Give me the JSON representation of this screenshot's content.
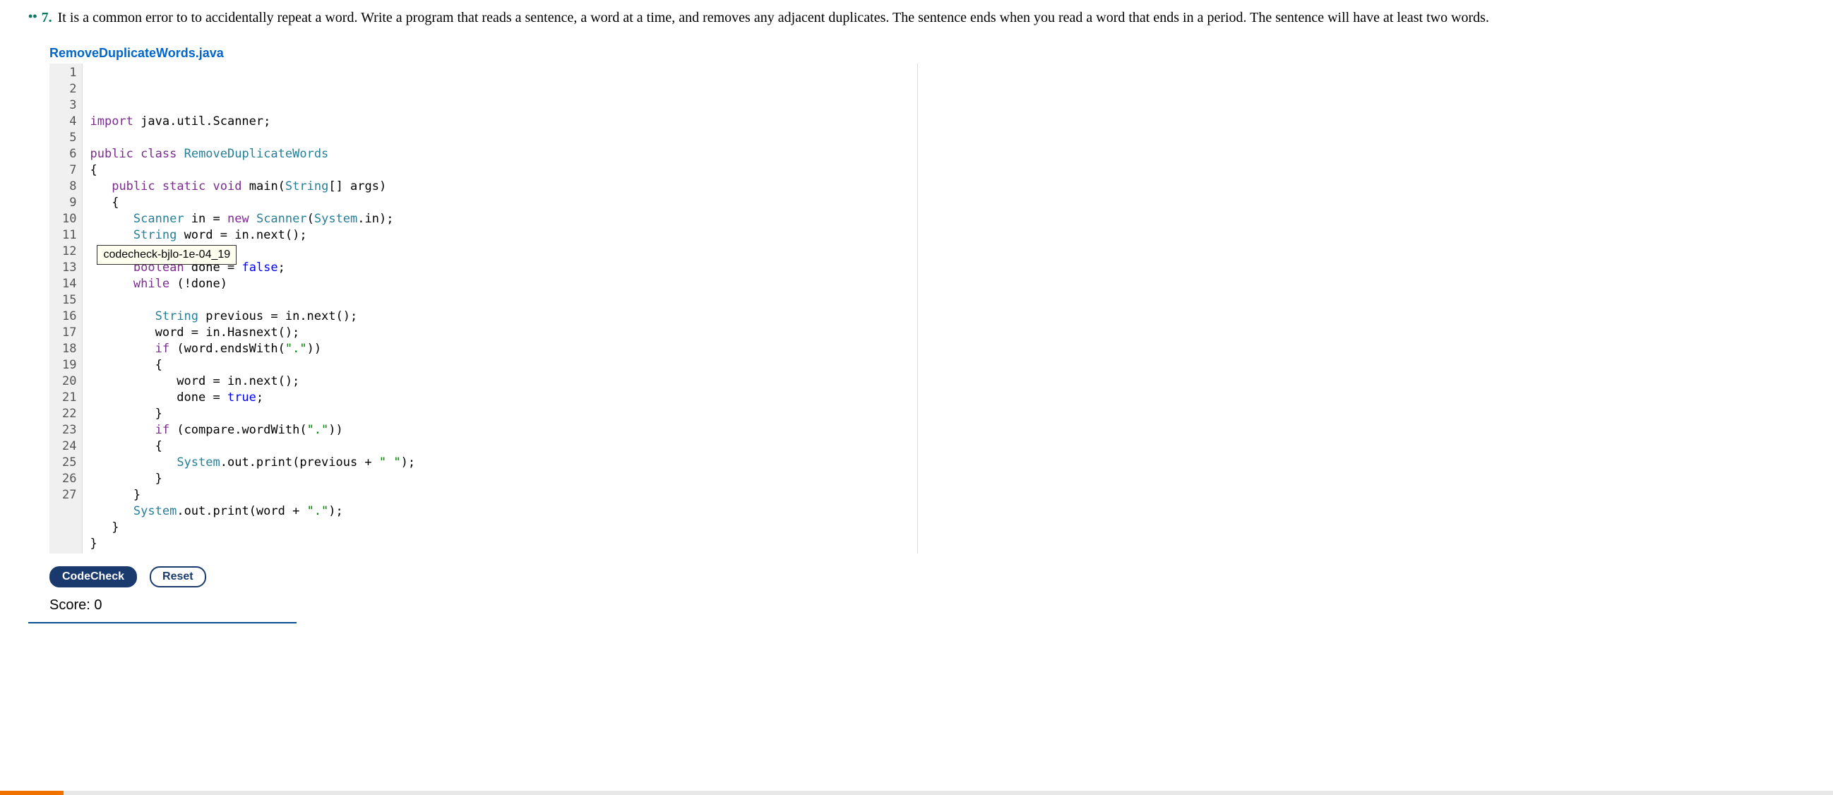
{
  "problem": {
    "bullets": "••",
    "number": "7.",
    "text": "It is a common error to to accidentally repeat a word. Write a program that reads a sentence, a word at a time, and removes any adjacent duplicates. The sentence ends when you read a word that ends in a period. The sentence will have at least two words."
  },
  "filename": "RemoveDuplicateWords.java",
  "tooltip": "codecheck-bjlo-1e-04_19",
  "code": {
    "lines": [
      {
        "n": "1",
        "tokens": [
          {
            "t": "import",
            "c": "kw-purple"
          },
          {
            "t": " java.util.Scanner;",
            "c": "ident"
          }
        ]
      },
      {
        "n": "2",
        "tokens": []
      },
      {
        "n": "3",
        "tokens": [
          {
            "t": "public",
            "c": "kw-purple"
          },
          {
            "t": " ",
            "c": ""
          },
          {
            "t": "class",
            "c": "kw-purple"
          },
          {
            "t": " ",
            "c": ""
          },
          {
            "t": "RemoveDuplicateWords",
            "c": "type"
          }
        ]
      },
      {
        "n": "4",
        "tokens": [
          {
            "t": "{",
            "c": "ident"
          }
        ]
      },
      {
        "n": "5",
        "tokens": [
          {
            "t": "   ",
            "c": ""
          },
          {
            "t": "public",
            "c": "kw-purple"
          },
          {
            "t": " ",
            "c": ""
          },
          {
            "t": "static",
            "c": "kw-purple"
          },
          {
            "t": " ",
            "c": ""
          },
          {
            "t": "void",
            "c": "kw-purple"
          },
          {
            "t": " main(",
            "c": "ident"
          },
          {
            "t": "String",
            "c": "type"
          },
          {
            "t": "[] args)",
            "c": "ident"
          }
        ]
      },
      {
        "n": "6",
        "tokens": [
          {
            "t": "   {",
            "c": "ident"
          }
        ]
      },
      {
        "n": "7",
        "tokens": [
          {
            "t": "      ",
            "c": ""
          },
          {
            "t": "Scanner",
            "c": "type"
          },
          {
            "t": " in = ",
            "c": "ident"
          },
          {
            "t": "new",
            "c": "kw-purple"
          },
          {
            "t": " ",
            "c": ""
          },
          {
            "t": "Scanner",
            "c": "type"
          },
          {
            "t": "(",
            "c": "ident"
          },
          {
            "t": "System",
            "c": "type"
          },
          {
            "t": ".in);",
            "c": "ident"
          }
        ]
      },
      {
        "n": "8",
        "tokens": [
          {
            "t": "      ",
            "c": ""
          },
          {
            "t": "String",
            "c": "type"
          },
          {
            "t": " word = in.next();",
            "c": "ident"
          }
        ]
      },
      {
        "n": "9",
        "tokens": []
      },
      {
        "n": "10",
        "tokens": [
          {
            "t": "      ",
            "c": ""
          },
          {
            "t": "boolean",
            "c": "kw-purple"
          },
          {
            "t": " done = ",
            "c": "ident"
          },
          {
            "t": "false",
            "c": "bool"
          },
          {
            "t": ";",
            "c": "ident"
          }
        ]
      },
      {
        "n": "11",
        "tokens": [
          {
            "t": "      ",
            "c": ""
          },
          {
            "t": "while",
            "c": "kw-purple"
          },
          {
            "t": " (!done)",
            "c": "ident"
          }
        ]
      },
      {
        "n": "12",
        "tokens": []
      },
      {
        "n": "13",
        "tokens": [
          {
            "t": "         ",
            "c": ""
          },
          {
            "t": "String",
            "c": "type"
          },
          {
            "t": " previous = in.next();",
            "c": "ident"
          }
        ]
      },
      {
        "n": "14",
        "tokens": [
          {
            "t": "         word = in.Hasnext();",
            "c": "ident"
          }
        ]
      },
      {
        "n": "15",
        "tokens": [
          {
            "t": "         ",
            "c": ""
          },
          {
            "t": "if",
            "c": "kw-purple"
          },
          {
            "t": " (word.endsWith(",
            "c": "ident"
          },
          {
            "t": "\".\"",
            "c": "str"
          },
          {
            "t": "))",
            "c": "ident"
          }
        ]
      },
      {
        "n": "16",
        "tokens": [
          {
            "t": "         {",
            "c": "ident"
          }
        ]
      },
      {
        "n": "17",
        "tokens": [
          {
            "t": "            word = in.next();",
            "c": "ident"
          }
        ]
      },
      {
        "n": "18",
        "tokens": [
          {
            "t": "            done = ",
            "c": "ident"
          },
          {
            "t": "true",
            "c": "bool"
          },
          {
            "t": ";",
            "c": "ident"
          }
        ]
      },
      {
        "n": "19",
        "tokens": [
          {
            "t": "         }",
            "c": "ident"
          }
        ]
      },
      {
        "n": "20",
        "tokens": [
          {
            "t": "         ",
            "c": ""
          },
          {
            "t": "if",
            "c": "kw-purple"
          },
          {
            "t": " (compare.wordWith(",
            "c": "ident"
          },
          {
            "t": "\".\"",
            "c": "str"
          },
          {
            "t": "))",
            "c": "ident"
          }
        ]
      },
      {
        "n": "21",
        "tokens": [
          {
            "t": "         {",
            "c": "ident"
          }
        ]
      },
      {
        "n": "22",
        "tokens": [
          {
            "t": "            ",
            "c": ""
          },
          {
            "t": "System",
            "c": "type"
          },
          {
            "t": ".out.print(previous + ",
            "c": "ident"
          },
          {
            "t": "\" \"",
            "c": "str"
          },
          {
            "t": ");",
            "c": "ident"
          }
        ]
      },
      {
        "n": "23",
        "tokens": [
          {
            "t": "         }",
            "c": "ident"
          }
        ]
      },
      {
        "n": "24",
        "tokens": [
          {
            "t": "      }",
            "c": "ident"
          }
        ]
      },
      {
        "n": "25",
        "tokens": [
          {
            "t": "      ",
            "c": ""
          },
          {
            "t": "System",
            "c": "type"
          },
          {
            "t": ".out.print(word + ",
            "c": "ident"
          },
          {
            "t": "\".\"",
            "c": "str"
          },
          {
            "t": ");",
            "c": "ident"
          }
        ]
      },
      {
        "n": "26",
        "tokens": [
          {
            "t": "   }",
            "c": "ident"
          }
        ]
      },
      {
        "n": "27",
        "tokens": [
          {
            "t": "}",
            "c": "ident"
          }
        ]
      }
    ]
  },
  "buttons": {
    "codecheck": "CodeCheck",
    "reset": "Reset"
  },
  "score_label": "Score: 0"
}
